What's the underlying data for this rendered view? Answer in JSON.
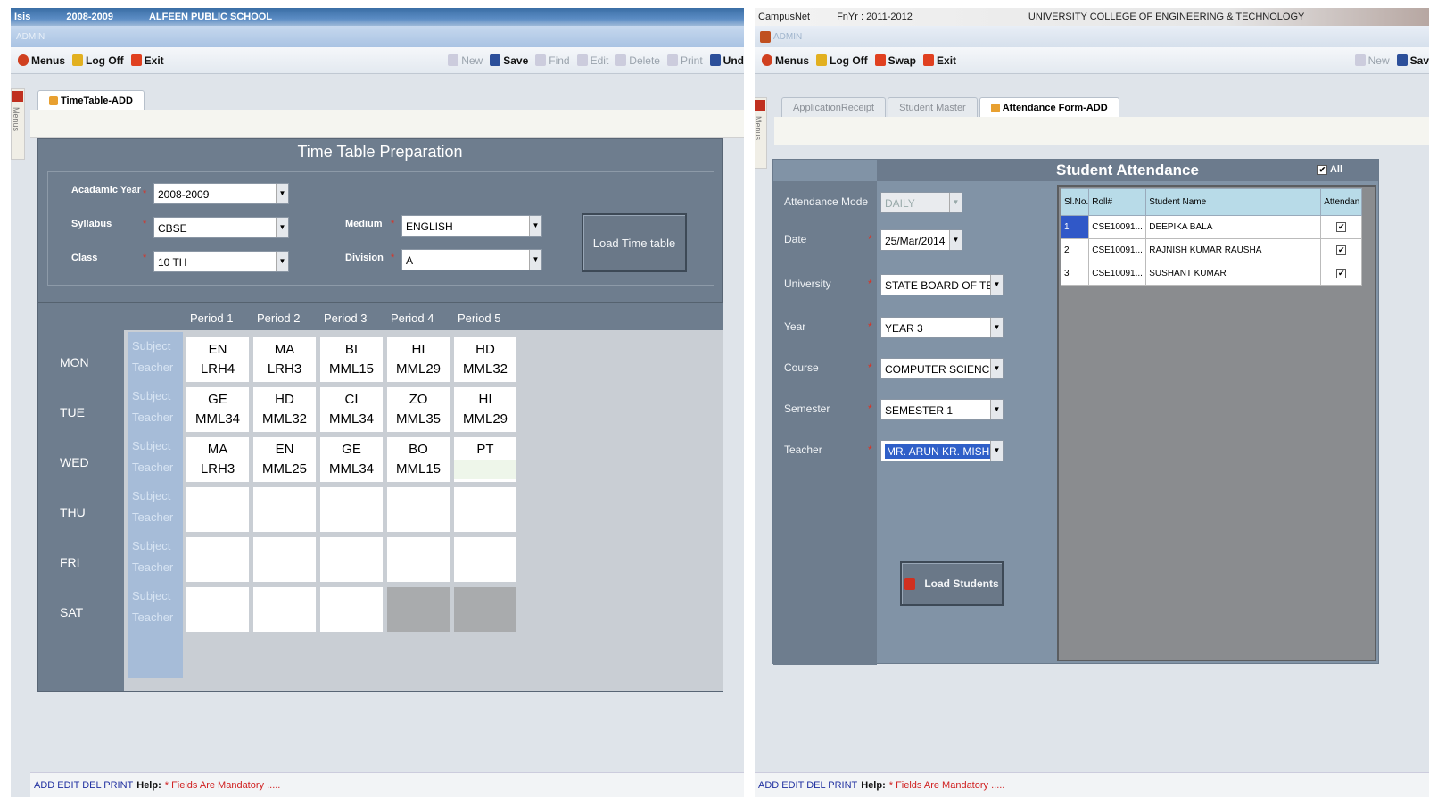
{
  "left": {
    "title": {
      "app": "Isis",
      "year": "2008-2009",
      "school": "ALFEEN PUBLIC SCHOOL"
    },
    "user": "ADMIN",
    "toolbar": [
      {
        "label": "Menus",
        "icon": "menus-icon",
        "enabled": true,
        "color": "#d04020"
      },
      {
        "label": "Log Off",
        "icon": "logoff-icon",
        "enabled": true,
        "color": "#e2b020"
      },
      {
        "label": "Exit",
        "icon": "exit-icon",
        "enabled": true,
        "color": "#e04020"
      }
    ],
    "toolbar_right": [
      {
        "label": "New",
        "icon": "new-icon",
        "enabled": false
      },
      {
        "label": "Save",
        "icon": "save-icon",
        "enabled": true
      },
      {
        "label": "Find",
        "icon": "find-icon",
        "enabled": false
      },
      {
        "label": "Edit",
        "icon": "edit-icon",
        "enabled": false
      },
      {
        "label": "Delete",
        "icon": "delete-icon",
        "enabled": false
      },
      {
        "label": "Print",
        "icon": "print-icon",
        "enabled": false
      },
      {
        "label": "Und",
        "icon": "undo-icon",
        "enabled": true
      }
    ],
    "side_label": "Menus",
    "tab": "TimeTable-ADD",
    "form": {
      "title": "Time Table Preparation",
      "academic_year_label": "Acadamic Year",
      "academic_year": "2008-2009",
      "syllabus_label": "Syllabus",
      "syllabus": "CBSE",
      "class_label": "Class",
      "class": "10 TH",
      "medium_label": "Medium",
      "medium": "ENGLISH",
      "division_label": "Division",
      "division": "A",
      "load_button": "Load Time table"
    },
    "periods": [
      "Period 1",
      "Period 2",
      "Period 3",
      "Period 4",
      "Period 5"
    ],
    "row_labels": {
      "subject": "Subject",
      "teacher": "Teacher"
    },
    "days": [
      {
        "name": "MON",
        "cells": [
          [
            "EN",
            "LRH4"
          ],
          [
            "MA",
            "LRH3"
          ],
          [
            "BI",
            "MML15"
          ],
          [
            "HI",
            "MML29"
          ],
          [
            "HD",
            "MML32"
          ]
        ]
      },
      {
        "name": "TUE",
        "cells": [
          [
            "GE",
            "MML34"
          ],
          [
            "HD",
            "MML32"
          ],
          [
            "CI",
            "MML34"
          ],
          [
            "ZO",
            "MML35"
          ],
          [
            "HI",
            "MML29"
          ]
        ]
      },
      {
        "name": "WED",
        "cells": [
          [
            "MA",
            "LRH3"
          ],
          [
            "EN",
            "MML25"
          ],
          [
            "GE",
            "MML34"
          ],
          [
            "BO",
            "MML15"
          ],
          [
            "PT",
            ""
          ]
        ]
      },
      {
        "name": "THU",
        "cells": [
          [
            "",
            ""
          ],
          [
            "",
            ""
          ],
          [
            "",
            ""
          ],
          [
            "",
            ""
          ],
          [
            "",
            ""
          ]
        ]
      },
      {
        "name": "FRI",
        "cells": [
          [
            "",
            ""
          ],
          [
            "",
            ""
          ],
          [
            "",
            ""
          ],
          [
            "",
            ""
          ],
          [
            "",
            ""
          ]
        ]
      },
      {
        "name": "SAT",
        "cells": [
          [
            "",
            ""
          ],
          [
            "",
            ""
          ],
          [
            "",
            ""
          ],
          null,
          null
        ]
      }
    ],
    "status": {
      "links": "ADD EDIT DEL PRINT",
      "help": "Help:",
      "note": "* Fields Are Mandatory ....."
    }
  },
  "right": {
    "title": {
      "app": "CampusNet",
      "year": "FnYr : 2011-2012",
      "college": "UNIVERSITY COLLEGE OF ENGINEERING & TECHNOLOGY"
    },
    "user": "ADMIN",
    "toolbar": [
      {
        "label": "Menus",
        "icon": "menus-icon",
        "color": "#d04020"
      },
      {
        "label": "Log Off",
        "icon": "logoff-icon",
        "color": "#e2b020"
      },
      {
        "label": "Swap",
        "icon": "swap-icon",
        "color": "#e04020"
      },
      {
        "label": "Exit",
        "icon": "exit-icon",
        "color": "#e04020"
      }
    ],
    "toolbar_right": [
      {
        "label": "New",
        "enabled": false
      },
      {
        "label": "Sav",
        "enabled": true
      }
    ],
    "tabs": [
      "ApplicationReceipt",
      "Student Master",
      "Attendance Form-ADD"
    ],
    "form": {
      "title": "Student Attendance",
      "all_label": "All",
      "fields": [
        {
          "label": "Attendance Mode",
          "value": "DAILY",
          "disabled": true
        },
        {
          "label": "Date",
          "value": "25/Mar/2014"
        },
        {
          "label": "University",
          "value": "STATE BOARD OF TECH"
        },
        {
          "label": "Year",
          "value": "YEAR 3"
        },
        {
          "label": "Course",
          "value": "COMPUTER SCIENCE AN"
        },
        {
          "label": "Semester",
          "value": "SEMESTER 1"
        },
        {
          "label": "Teacher",
          "value": "MR. ARUN KR. MISHRA"
        }
      ],
      "load_button": "Load Students",
      "columns": [
        "Sl.No.",
        "Roll#",
        "Student Name",
        "Attendan"
      ],
      "students": [
        {
          "sl": "1",
          "roll": "CSE10091...",
          "name": "DEEPIKA BALA",
          "present": true
        },
        {
          "sl": "2",
          "roll": "CSE10091...",
          "name": "RAJNISH KUMAR RAUSHA",
          "present": true
        },
        {
          "sl": "3",
          "roll": "CSE10091...",
          "name": "SUSHANT KUMAR",
          "present": true
        }
      ]
    },
    "status": {
      "links": "ADD EDIT DEL PRINT",
      "help": "Help:",
      "note": "* Fields Are Mandatory ....."
    }
  }
}
